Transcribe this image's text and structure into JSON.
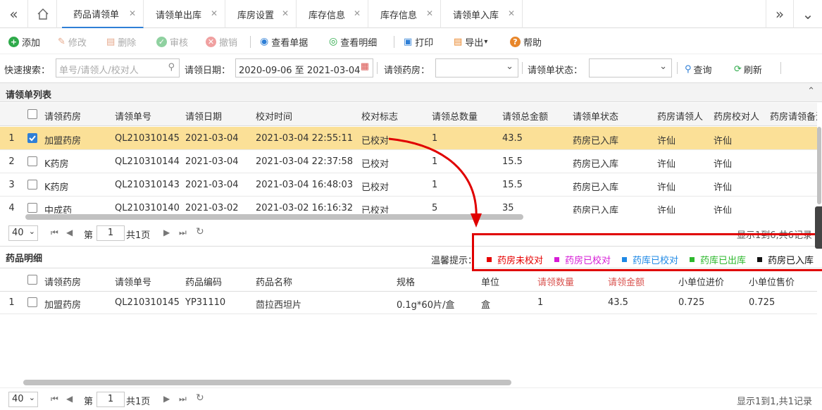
{
  "tabs": [
    {
      "label": "药品请领单",
      "active": true
    },
    {
      "label": "请领单出库"
    },
    {
      "label": "库房设置"
    },
    {
      "label": "库存信息"
    },
    {
      "label": "库存信息"
    },
    {
      "label": "请领单入库"
    }
  ],
  "toolbar": {
    "add": "添加",
    "edit": "修改",
    "delete": "删除",
    "audit": "审核",
    "revoke": "撤销",
    "view_doc": "查看单据",
    "view_detail": "查看明细",
    "print": "打印",
    "export": "导出",
    "help": "帮助"
  },
  "search": {
    "quick_label": "快速搜索：",
    "quick_placeholder": "单号/请领人/校对人",
    "date_label": "请领日期：",
    "date_value": "2020-09-06 至 2021-03-04",
    "pharmacy_label": "请领药房：",
    "status_label": "请领单状态：",
    "query": "查询",
    "refresh": "刷新"
  },
  "list_panel": {
    "title": "请领单列表",
    "columns": [
      "请领药房",
      "请领单号",
      "请领日期",
      "校对时间",
      "校对标志",
      "请领总数量",
      "请领总金额",
      "请领单状态",
      "药房请领人",
      "药房校对人",
      "药房请领备注"
    ],
    "rows": [
      {
        "num": "1",
        "checked": true,
        "pharmacy": "加盟药房",
        "no": "QL210310145",
        "date": "2021-03-04",
        "check_time": "2021-03-04 22:55:11",
        "flag": "已校对",
        "qty": "1",
        "amount": "43.5",
        "status": "药房已入库",
        "requester": "许仙",
        "checker": "许仙"
      },
      {
        "num": "2",
        "checked": false,
        "pharmacy": "K药房",
        "no": "QL210310144",
        "date": "2021-03-04",
        "check_time": "2021-03-04 22:37:58",
        "flag": "已校对",
        "qty": "1",
        "amount": "15.5",
        "status": "药房已入库",
        "requester": "许仙",
        "checker": "许仙"
      },
      {
        "num": "3",
        "checked": false,
        "pharmacy": "K药房",
        "no": "QL210310143",
        "date": "2021-03-04",
        "check_time": "2021-03-04 16:48:03",
        "flag": "已校对",
        "qty": "1",
        "amount": "15.5",
        "status": "药房已入库",
        "requester": "许仙",
        "checker": "许仙"
      },
      {
        "num": "4",
        "checked": false,
        "pharmacy": "中成药",
        "no": "QL210310140",
        "date": "2021-03-02",
        "check_time": "2021-03-02 16:16:32",
        "flag": "已校对",
        "qty": "5",
        "amount": "35",
        "status": "药房已入库",
        "requester": "许仙",
        "checker": "许仙"
      }
    ],
    "pager": {
      "size": "40",
      "page_prefix": "第",
      "page": "1",
      "page_suffix": "共1页",
      "summary": "显示1到6,共6记录"
    }
  },
  "detail_panel": {
    "title": "药品明细",
    "tip_label": "温馨提示：",
    "legend": [
      {
        "label": "药房未校对",
        "color": "#e60000"
      },
      {
        "label": "药房已校对",
        "color": "#d61cd6"
      },
      {
        "label": "药库已校对",
        "color": "#1e88e5"
      },
      {
        "label": "药库已出库",
        "color": "#2eb82e"
      },
      {
        "label": "药房已入库",
        "color": "#111111"
      }
    ],
    "columns": [
      "请领药房",
      "请领单号",
      "药品编码",
      "药品名称",
      "规格",
      "单位",
      "请领数量",
      "请领金额",
      "小单位进价",
      "小单位售价"
    ],
    "rows": [
      {
        "num": "1",
        "pharmacy": "加盟药房",
        "no": "QL210310145",
        "code": "YP31110",
        "name": "茴拉西坦片",
        "spec": "0.1g*60片/盒",
        "unit": "盒",
        "qty": "1",
        "amount": "43.5",
        "cost": "0.725",
        "price": "0.725"
      }
    ],
    "pager": {
      "size": "40",
      "page_prefix": "第",
      "page": "1",
      "page_suffix": "共1页",
      "summary": "显示1到1,共1记录"
    }
  },
  "colors": {
    "accent": "#2f7fd6",
    "selected_row": "#fbe097",
    "highlight": "#e00000"
  }
}
